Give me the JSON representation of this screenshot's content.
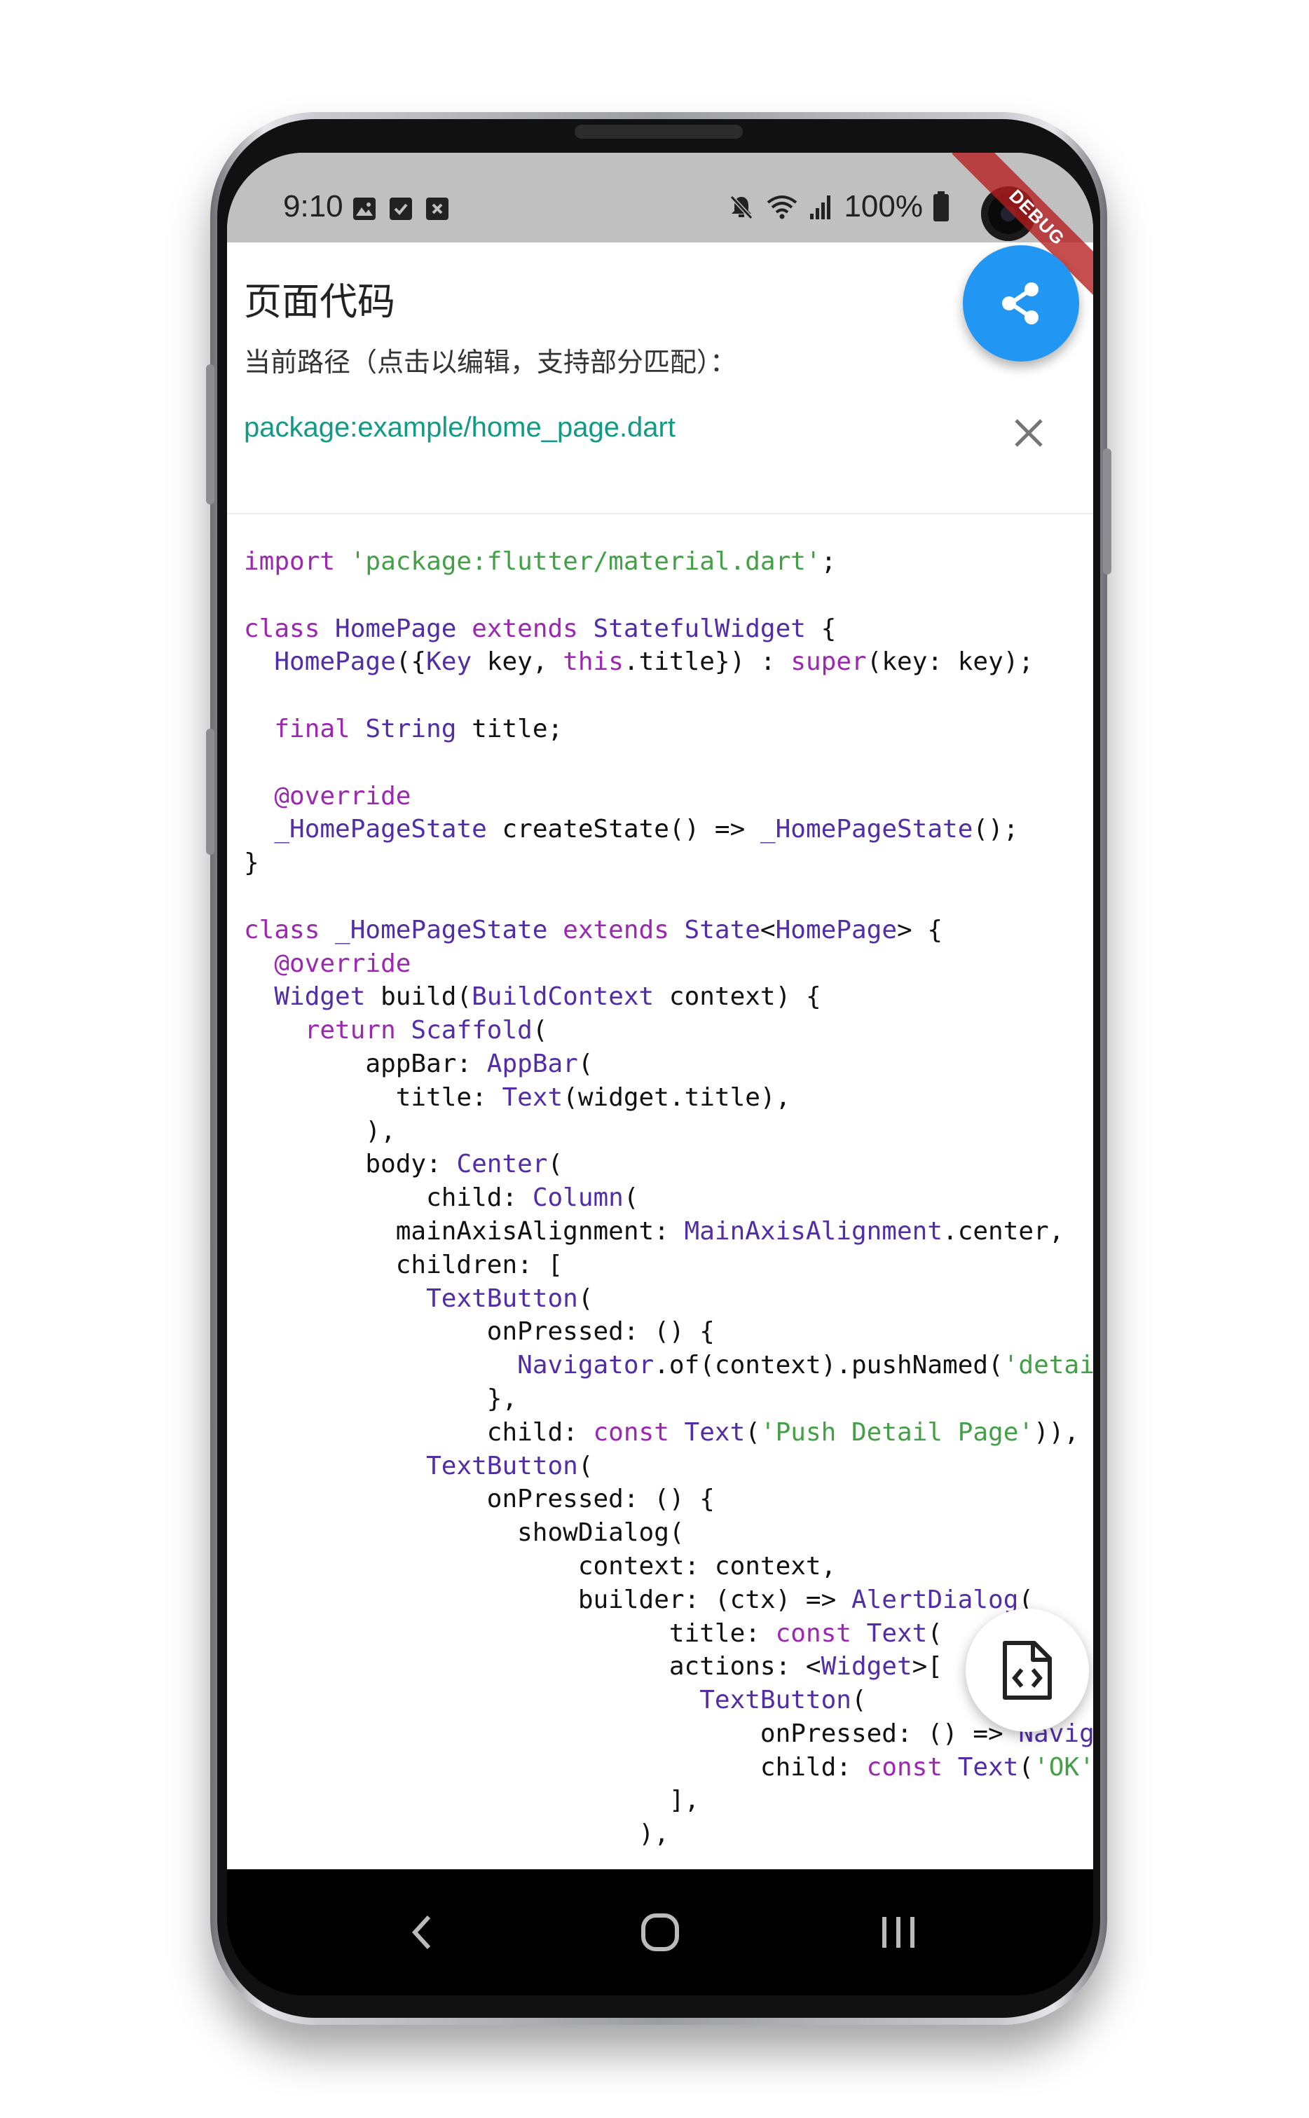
{
  "status_bar": {
    "time": "9:10",
    "left_icons": [
      "image-icon",
      "checkbox-icon",
      "close-box-icon"
    ],
    "battery": "100%",
    "right_icons": [
      "mute-icon",
      "wifi-icon",
      "signal-icon",
      "battery-icon"
    ],
    "debug_label": "DEBUG"
  },
  "header": {
    "title": "页面代码",
    "route_label": "当前路径（点击以编辑，支持部分匹配）：",
    "route_value": "package:example/home_page.dart"
  },
  "colors": {
    "accent": "#2196f3",
    "route_text": "#129a84",
    "keyword": "#9c27b0",
    "type": "#512da8",
    "string": "#43a047"
  },
  "code_lines": [
    [
      [
        "kw",
        "import "
      ],
      [
        "str",
        "'package:flutter/material.dart'"
      ],
      [
        "plain",
        ";"
      ]
    ],
    [],
    [
      [
        "kw",
        "class "
      ],
      [
        "type",
        "HomePage "
      ],
      [
        "kw",
        "extends "
      ],
      [
        "type",
        "StatefulWidget "
      ],
      [
        "plain",
        "{"
      ]
    ],
    [
      [
        "plain",
        "  "
      ],
      [
        "type",
        "HomePage"
      ],
      [
        "plain",
        "({"
      ],
      [
        "type",
        "Key"
      ],
      [
        "plain",
        " key, "
      ],
      [
        "kw",
        "this"
      ],
      [
        "plain",
        ".title}) : "
      ],
      [
        "kw",
        "super"
      ],
      [
        "plain",
        "(key: key);"
      ]
    ],
    [],
    [
      [
        "plain",
        "  "
      ],
      [
        "kw",
        "final "
      ],
      [
        "type",
        "String"
      ],
      [
        "plain",
        " title;"
      ]
    ],
    [],
    [
      [
        "plain",
        "  "
      ],
      [
        "kw",
        "@override"
      ]
    ],
    [
      [
        "plain",
        "  "
      ],
      [
        "type",
        "_HomePageState"
      ],
      [
        "plain",
        " createState() => "
      ],
      [
        "type",
        "_HomePageState"
      ],
      [
        "plain",
        "();"
      ]
    ],
    [
      [
        "plain",
        "}"
      ]
    ],
    [],
    [
      [
        "kw",
        "class "
      ],
      [
        "type",
        "_HomePageState "
      ],
      [
        "kw",
        "extends "
      ],
      [
        "type",
        "State"
      ],
      [
        "plain",
        "<"
      ],
      [
        "type",
        "HomePage"
      ],
      [
        "plain",
        "> {"
      ]
    ],
    [
      [
        "plain",
        "  "
      ],
      [
        "kw",
        "@override"
      ]
    ],
    [
      [
        "plain",
        "  "
      ],
      [
        "type",
        "Widget"
      ],
      [
        "plain",
        " build("
      ],
      [
        "type",
        "BuildContext"
      ],
      [
        "plain",
        " context) {"
      ]
    ],
    [
      [
        "plain",
        "    "
      ],
      [
        "kw",
        "return "
      ],
      [
        "type",
        "Scaffold"
      ],
      [
        "plain",
        "("
      ]
    ],
    [
      [
        "plain",
        "        appBar: "
      ],
      [
        "type",
        "AppBar"
      ],
      [
        "plain",
        "("
      ]
    ],
    [
      [
        "plain",
        "          title: "
      ],
      [
        "type",
        "Text"
      ],
      [
        "plain",
        "(widget.title),"
      ]
    ],
    [
      [
        "plain",
        "        ),"
      ]
    ],
    [
      [
        "plain",
        "        body: "
      ],
      [
        "type",
        "Center"
      ],
      [
        "plain",
        "("
      ]
    ],
    [
      [
        "plain",
        "            child: "
      ],
      [
        "type",
        "Column"
      ],
      [
        "plain",
        "("
      ]
    ],
    [
      [
        "plain",
        "          mainAxisAlignment: "
      ],
      [
        "type",
        "MainAxisAlignment"
      ],
      [
        "plain",
        ".center,"
      ]
    ],
    [
      [
        "plain",
        "          children: ["
      ]
    ],
    [
      [
        "plain",
        "            "
      ],
      [
        "type",
        "TextButton"
      ],
      [
        "plain",
        "("
      ]
    ],
    [
      [
        "plain",
        "                onPressed: () {"
      ]
    ],
    [
      [
        "plain",
        "                  "
      ],
      [
        "type",
        "Navigator"
      ],
      [
        "plain",
        ".of(context).pushNamed("
      ],
      [
        "str",
        "'detai"
      ]
    ],
    [
      [
        "plain",
        "                },"
      ]
    ],
    [
      [
        "plain",
        "                child: "
      ],
      [
        "kw",
        "const "
      ],
      [
        "type",
        "Text"
      ],
      [
        "plain",
        "("
      ],
      [
        "str",
        "'Push Detail Page'"
      ],
      [
        "plain",
        ")),"
      ]
    ],
    [
      [
        "plain",
        "            "
      ],
      [
        "type",
        "TextButton"
      ],
      [
        "plain",
        "("
      ]
    ],
    [
      [
        "plain",
        "                onPressed: () {"
      ]
    ],
    [
      [
        "plain",
        "                  showDialog("
      ]
    ],
    [
      [
        "plain",
        "                      context: context,"
      ]
    ],
    [
      [
        "plain",
        "                      builder: (ctx) => "
      ],
      [
        "type",
        "AlertDialog"
      ],
      [
        "plain",
        "("
      ]
    ],
    [
      [
        "plain",
        "                            title: "
      ],
      [
        "kw",
        "const "
      ],
      [
        "type",
        "Text"
      ],
      [
        "plain",
        "("
      ]
    ],
    [
      [
        "plain",
        "                            actions: <"
      ],
      [
        "type",
        "Widget"
      ],
      [
        "plain",
        ">["
      ]
    ],
    [
      [
        "plain",
        "                              "
      ],
      [
        "type",
        "TextButton"
      ],
      [
        "plain",
        "("
      ]
    ],
    [
      [
        "plain",
        "                                  onPressed: () => "
      ],
      [
        "type",
        "Navig"
      ]
    ],
    [
      [
        "plain",
        "                                  child: "
      ],
      [
        "kw",
        "const "
      ],
      [
        "type",
        "Text"
      ],
      [
        "plain",
        "("
      ],
      [
        "str",
        "'OK'"
      ]
    ],
    [
      [
        "plain",
        "                            ],"
      ]
    ],
    [
      [
        "plain",
        "                          ),"
      ]
    ]
  ],
  "nav_bar": {
    "buttons": [
      "back-icon",
      "home-icon",
      "recents-icon"
    ]
  }
}
